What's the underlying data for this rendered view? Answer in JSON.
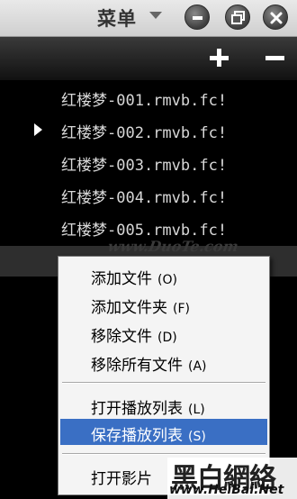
{
  "titlebar": {
    "menu_label": "菜单"
  },
  "playlist": {
    "items": [
      {
        "label": "红楼梦-001.rmvb.fc!",
        "playing": false
      },
      {
        "label": "红楼梦-002.rmvb.fc!",
        "playing": true
      },
      {
        "label": "红楼梦-003.rmvb.fc!",
        "playing": false
      },
      {
        "label": "红楼梦-004.rmvb.fc!",
        "playing": false
      },
      {
        "label": "红楼梦-005.rmvb.fc!",
        "playing": false
      }
    ],
    "watermark": "www.DuoTe.com"
  },
  "context_menu": {
    "items": [
      {
        "label": "添加文件",
        "shortcut": "(O)"
      },
      {
        "label": "添加文件夹",
        "shortcut": "(F)"
      },
      {
        "label": "移除文件",
        "shortcut": "(D)"
      },
      {
        "label": "移除所有文件",
        "shortcut": "(A)"
      },
      {
        "label": "打开播放列表",
        "shortcut": "(L)"
      },
      {
        "label": "保存播放列表",
        "shortcut": "(S)"
      },
      {
        "label": "打开影片",
        "shortcut": ""
      }
    ]
  },
  "logo": {
    "cjk": "黑白網絡",
    "url": "www.HeiBai.Net"
  },
  "colors": {
    "selection": "#3a6fc4",
    "list_text": "#d8d8d8"
  }
}
